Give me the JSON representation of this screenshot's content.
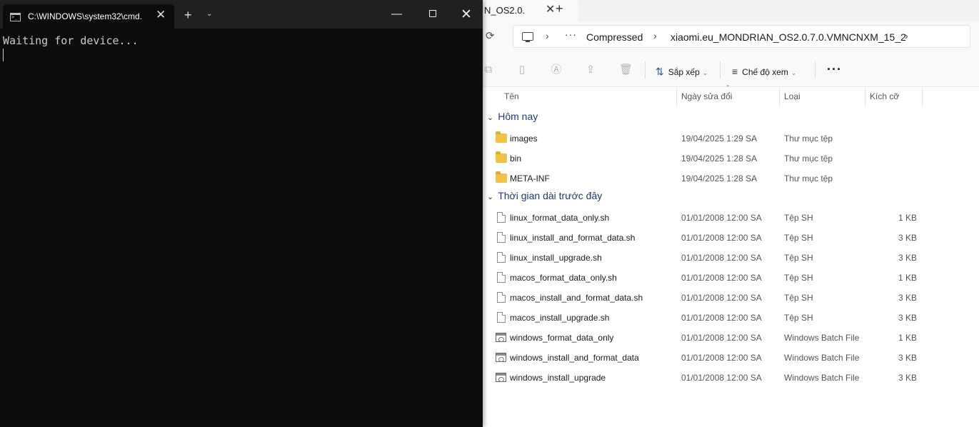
{
  "terminal": {
    "tab_title": "C:\\WINDOWS\\system32\\cmd.",
    "output_line": "Waiting for device...",
    "icons": {
      "tab": "cmd-icon",
      "close": "close-icon",
      "new_tab": "plus-icon",
      "dropdown": "chevron-down-icon"
    },
    "window_controls": {
      "minimize": "minimize-icon",
      "maximize": "maximize-icon",
      "close": "close-icon"
    },
    "glyphs": {
      "close": "✕",
      "plus": "+",
      "chevron": "⌄",
      "minimize": "—"
    }
  },
  "explorer": {
    "tab_title": "N_OS2.0.",
    "breadcrumb": {
      "more": "···",
      "items": [
        "Compressed",
        "xiaomi.eu_MONDRIAN_OS2.0.7.0.VMNCNXM_15_2"
      ],
      "sep": "›"
    },
    "toolbar": {
      "sort_label": "Sắp xếp",
      "view_label": "Chế độ xem",
      "more": "···",
      "sort_glyph": "⇅",
      "view_glyph": "≡",
      "chev": "⌄"
    },
    "columns": {
      "name": "Tên",
      "date": "Ngày sửa đổi",
      "type": "Loại",
      "size": "Kích cỡ"
    },
    "groups": [
      {
        "label": "Hôm nay",
        "items": [
          {
            "name": "images",
            "date": "19/04/2025 1:29 SA",
            "type": "Thư mục tệp",
            "size": "",
            "icon": "folder-icon"
          },
          {
            "name": "bin",
            "date": "19/04/2025 1:28 SA",
            "type": "Thư mục tệp",
            "size": "",
            "icon": "folder-icon"
          },
          {
            "name": "META-INF",
            "date": "19/04/2025 1:28 SA",
            "type": "Thư mục tệp",
            "size": "",
            "icon": "folder-icon"
          }
        ]
      },
      {
        "label": "Thời gian dài trước đây",
        "items": [
          {
            "name": "linux_format_data_only.sh",
            "date": "01/01/2008 12:00 SA",
            "type": "Tệp SH",
            "size": "1 KB",
            "icon": "file-icon"
          },
          {
            "name": "linux_install_and_format_data.sh",
            "date": "01/01/2008 12:00 SA",
            "type": "Tệp SH",
            "size": "3 KB",
            "icon": "file-icon"
          },
          {
            "name": "linux_install_upgrade.sh",
            "date": "01/01/2008 12:00 SA",
            "type": "Tệp SH",
            "size": "3 KB",
            "icon": "file-icon"
          },
          {
            "name": "macos_format_data_only.sh",
            "date": "01/01/2008 12:00 SA",
            "type": "Tệp SH",
            "size": "1 KB",
            "icon": "file-icon"
          },
          {
            "name": "macos_install_and_format_data.sh",
            "date": "01/01/2008 12:00 SA",
            "type": "Tệp SH",
            "size": "3 KB",
            "icon": "file-icon"
          },
          {
            "name": "macos_install_upgrade.sh",
            "date": "01/01/2008 12:00 SA",
            "type": "Tệp SH",
            "size": "3 KB",
            "icon": "file-icon"
          },
          {
            "name": "windows_format_data_only",
            "date": "01/01/2008 12:00 SA",
            "type": "Windows Batch File",
            "size": "1 KB",
            "icon": "batch-file-icon"
          },
          {
            "name": "windows_install_and_format_data",
            "date": "01/01/2008 12:00 SA",
            "type": "Windows Batch File",
            "size": "3 KB",
            "icon": "batch-file-icon"
          },
          {
            "name": "windows_install_upgrade",
            "date": "01/01/2008 12:00 SA",
            "type": "Windows Batch File",
            "size": "3 KB",
            "icon": "batch-file-icon"
          }
        ]
      }
    ]
  }
}
